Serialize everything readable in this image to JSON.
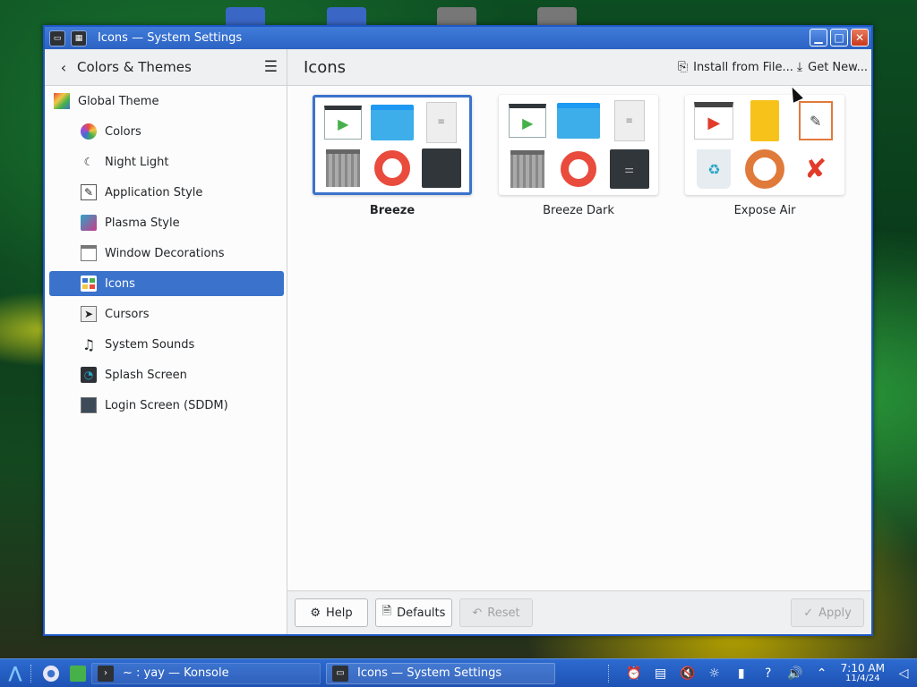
{
  "window": {
    "title": "Icons — System Settings"
  },
  "sidebar_header": {
    "title": "Colors & Themes"
  },
  "page": {
    "title": "Icons",
    "install_label": "Install from File...",
    "get_new_label": "Get New..."
  },
  "sidebar": {
    "global_theme": "Global Theme",
    "items": [
      {
        "label": "Colors",
        "icon": "color-wheel-icon"
      },
      {
        "label": "Night Light",
        "icon": "night-light-icon"
      },
      {
        "label": "Application Style",
        "icon": "application-style-icon"
      },
      {
        "label": "Plasma Style",
        "icon": "plasma-style-icon"
      },
      {
        "label": "Window Decorations",
        "icon": "window-decorations-icon"
      },
      {
        "label": "Icons",
        "icon": "icons-icon",
        "active": true
      },
      {
        "label": "Cursors",
        "icon": "cursor-icon"
      },
      {
        "label": "System Sounds",
        "icon": "music-note-icon"
      },
      {
        "label": "Splash Screen",
        "icon": "splash-screen-icon"
      },
      {
        "label": "Login Screen (SDDM)",
        "icon": "login-screen-icon"
      }
    ]
  },
  "themes": [
    {
      "name": "Breeze",
      "selected": true
    },
    {
      "name": "Breeze Dark",
      "selected": false
    },
    {
      "name": "Expose Air",
      "selected": false
    }
  ],
  "footer": {
    "help": "Help",
    "defaults": "Defaults",
    "reset": "Reset",
    "apply": "Apply"
  },
  "taskbar": {
    "task1": "~ : yay — Konsole",
    "task2": "Icons — System Settings",
    "time": "7:10 AM",
    "date": "11/4/24"
  },
  "colors": {
    "accent": "#3b73cc",
    "titlebar": "#2c63c4",
    "taskbar": "#1d52b4"
  }
}
